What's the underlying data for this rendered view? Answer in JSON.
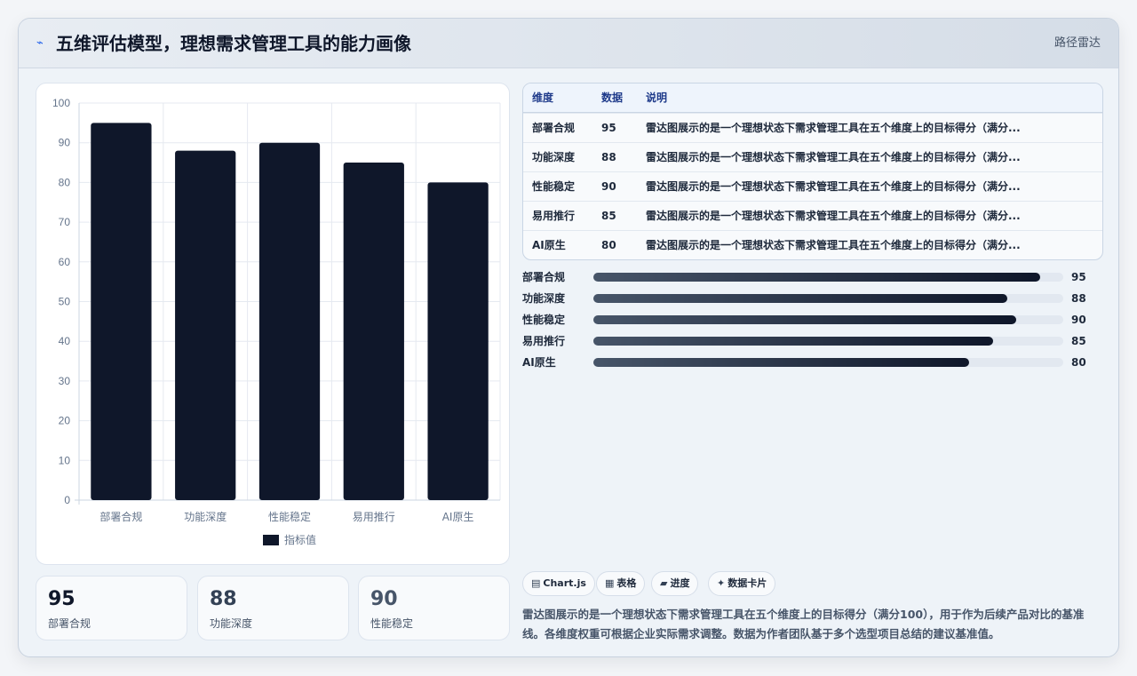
{
  "header": {
    "title": "五维评估模型，理想需求管理工具的能力画像",
    "tag": "路径雷达"
  },
  "chart_data": {
    "type": "bar",
    "categories": [
      "部署合规",
      "功能深度",
      "性能稳定",
      "易用推行",
      "AI原生"
    ],
    "series": [
      {
        "name": "指标值",
        "values": [
          95,
          88,
          90,
          85,
          80
        ]
      }
    ],
    "ylim": [
      0,
      100
    ],
    "yticks": [
      "0",
      "10",
      "20",
      "30",
      "40",
      "50",
      "60",
      "70",
      "80",
      "90",
      "100"
    ],
    "grid": true,
    "legend": "bottom",
    "bar_color": "#0f172a"
  },
  "kpis": [
    {
      "value": "95",
      "label": "部署合规",
      "color": "#0f172a"
    },
    {
      "value": "88",
      "label": "功能深度",
      "color": "#334155"
    },
    {
      "value": "90",
      "label": "性能稳定",
      "color": "#475569"
    }
  ],
  "table": {
    "headers": [
      "维度",
      "数据",
      "说明"
    ],
    "rows": [
      [
        "部署合规",
        "95",
        "雷达图展示的是一个理想状态下需求管理工具在五个维度上的目标得分（满分..."
      ],
      [
        "功能深度",
        "88",
        "雷达图展示的是一个理想状态下需求管理工具在五个维度上的目标得分（满分..."
      ],
      [
        "性能稳定",
        "90",
        "雷达图展示的是一个理想状态下需求管理工具在五个维度上的目标得分（满分..."
      ],
      [
        "易用推行",
        "85",
        "雷达图展示的是一个理想状态下需求管理工具在五个维度上的目标得分（满分..."
      ],
      [
        "AI原生",
        "80",
        "雷达图展示的是一个理想状态下需求管理工具在五个维度上的目标得分（满分..."
      ]
    ]
  },
  "progress": [
    {
      "label": "部署合规",
      "value": 95,
      "max": 100,
      "text": "95"
    },
    {
      "label": "功能深度",
      "value": 88,
      "max": 100,
      "text": "88"
    },
    {
      "label": "性能稳定",
      "value": 90,
      "max": 100,
      "text": "90"
    },
    {
      "label": "易用推行",
      "value": 85,
      "max": 100,
      "text": "85"
    },
    {
      "label": "AI原生",
      "value": 80,
      "max": 100,
      "text": "80"
    }
  ],
  "chips": [
    {
      "icon": "▤",
      "icon_name": "chart-icon",
      "label": "Chart.js"
    },
    {
      "icon": "▦",
      "icon_name": "table-icon",
      "label": "表格"
    },
    {
      "icon": "▰",
      "icon_name": "progress-icon",
      "label": "进度"
    },
    {
      "icon": "✦",
      "icon_name": "card-icon",
      "label": "数据卡片"
    }
  ],
  "description": "雷达图展示的是一个理想状态下需求管理工具在五个维度上的目标得分（满分100），用于作为后续产品对比的基准线。各维度权重可根据企业实际需求调整。数据为作者团队基于多个选型项目总结的建议基准值。"
}
